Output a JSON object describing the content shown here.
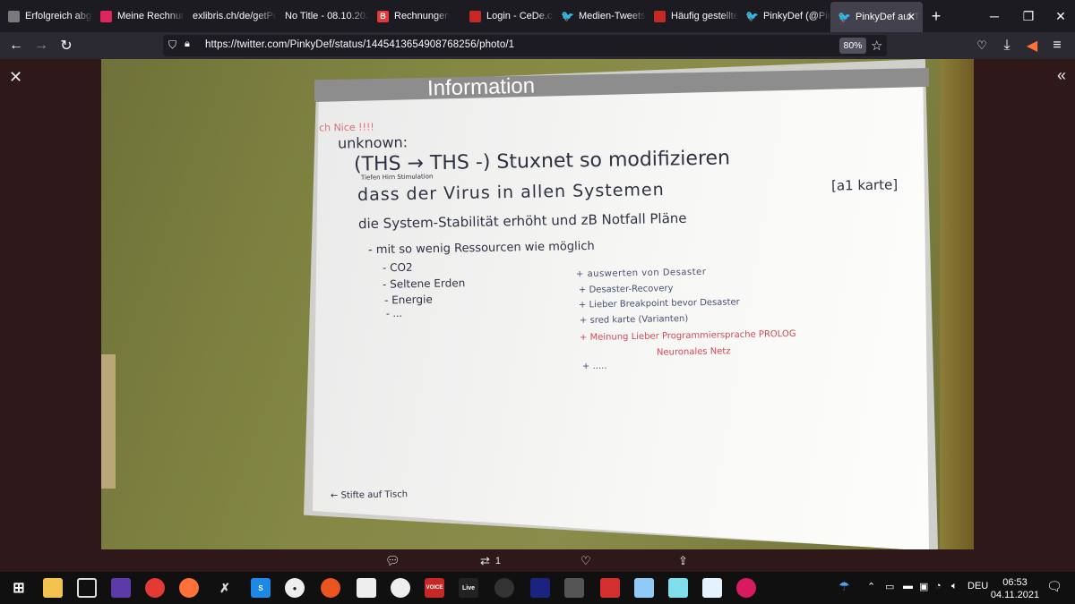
{
  "browser": {
    "tabs": [
      {
        "label": "Erfolgreich abge",
        "fav": "#7a7a7a"
      },
      {
        "label": "Meine Rechnunge",
        "fav": "#e0245e"
      },
      {
        "label": "exlibris.ch/de/getPdf",
        "fav": ""
      },
      {
        "label": "No Title - 08.10.2021",
        "fav": ""
      },
      {
        "label": "Rechnungen",
        "fav": "#e53935"
      },
      {
        "label": "Login - CeDe.ch",
        "fav": "#c62828"
      },
      {
        "label": "Medien-Tweets v",
        "fav": "#1d9bf0"
      },
      {
        "label": "Häufig gestellte",
        "fav": "#c62828"
      },
      {
        "label": "PinkyDef (@Pink",
        "fav": "#1d9bf0"
      },
      {
        "label": "PinkyDef auf T",
        "fav": "#1d9bf0"
      }
    ],
    "url": "https://twitter.com/PinkyDef/status/1445413654908768256/photo/1",
    "zoom": "80%"
  },
  "whiteboard": {
    "title": "Information",
    "line_nice": "ch Nice !!!!",
    "line_unknown": "unknown:",
    "line_ths": "(THS → THS -) Stuxnet so modifizieren",
    "line_ths_sub": "Tiefen Hirn Stimulation",
    "line_dass": "dass der Virus in allen Systemen",
    "line_karte": "[a1 karte]",
    "line_system": "die System-Stabilität erhöht und zB Notfall Pläne",
    "line_ressourcen": "- mit so wenig Ressourcen wie möglich",
    "left_list": [
      "- CO2",
      "- Seltene Erden",
      "- Energie",
      "- ..."
    ],
    "right_list": [
      "+ auswerten von Desaster",
      "+ Desaster-Recovery",
      "+ Lieber Breakpoint bevor Desaster",
      "+ sred karte (Varianten)"
    ],
    "red_1": "+ Meinung Lieber Programmiersprache PROLOG",
    "red_2": "Neuronales Netz",
    "plus_more": "+ .....",
    "bottom_note": "← Stifte auf Tisch"
  },
  "tweet_actions": {
    "retweet_count": "1"
  },
  "taskbar": {
    "tray_lang": "DEU",
    "time": "06:53",
    "date": "04.11.2021"
  }
}
